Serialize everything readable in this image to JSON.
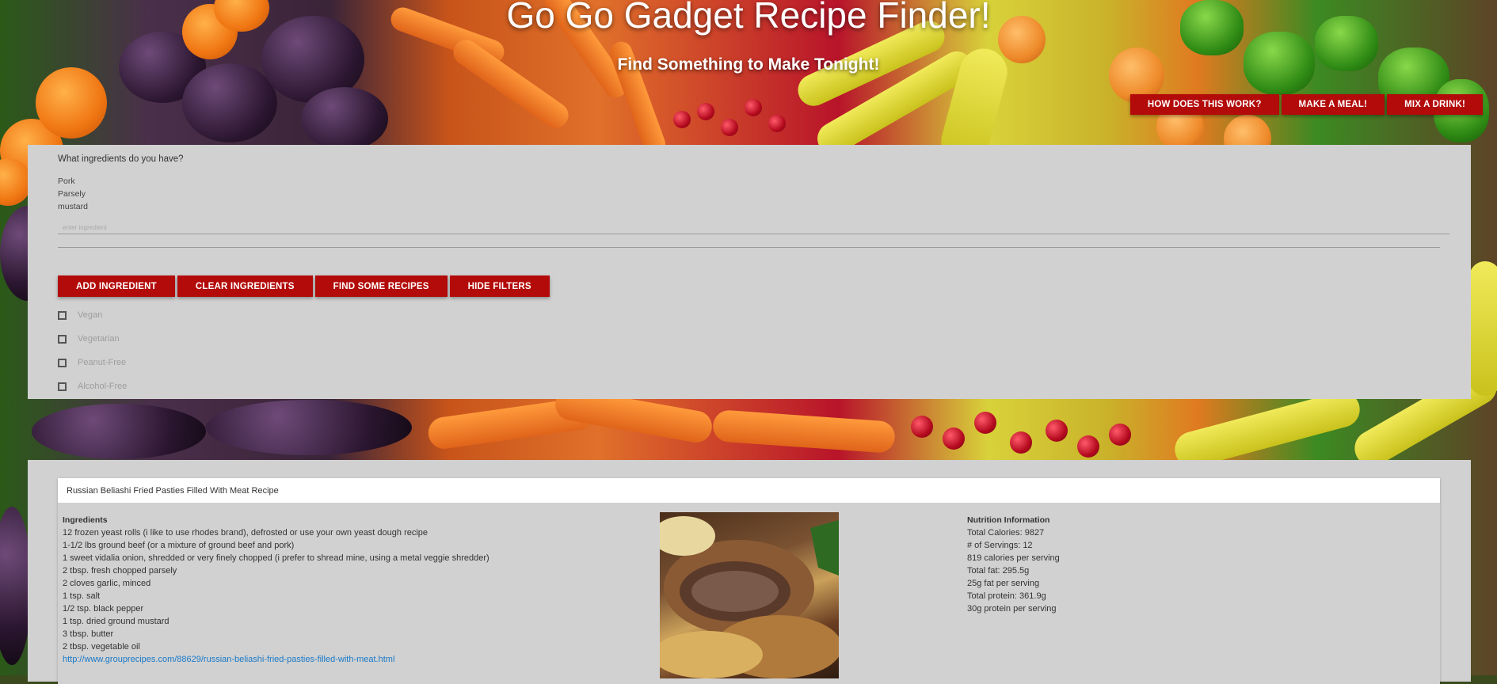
{
  "header": {
    "title": "Go Go Gadget Recipe Finder!",
    "subtitle": "Find Something to Make Tonight!",
    "nav": [
      "HOW DOES THIS WORK?",
      "MAKE A MEAL!",
      "MIX A DRINK!"
    ]
  },
  "search": {
    "prompt": "What ingredients do you have?",
    "ingredients": [
      "Pork",
      "Parsely",
      "mustard"
    ],
    "input_placeholder": "enter ingredient",
    "input_value": "",
    "actions": [
      "ADD INGREDIENT",
      "CLEAR INGREDIENTS",
      "FIND SOME RECIPES",
      "HIDE FILTERS"
    ],
    "filters": [
      {
        "label": "Vegan",
        "checked": false
      },
      {
        "label": "Vegetarian",
        "checked": false
      },
      {
        "label": "Peanut-Free",
        "checked": false
      },
      {
        "label": "Alcohol-Free",
        "checked": false
      }
    ]
  },
  "result": {
    "title": "Russian Beliashi Fried Pasties Filled With Meat Recipe",
    "ingredients_header": "Ingredients",
    "ingredients": [
      "12 frozen yeast rolls (i like to use rhodes brand), defrosted or use your own yeast dough recipe",
      "1-1/2 lbs ground beef (or a mixture of ground beef and pork)",
      "1 sweet vidalia onion, shredded or very finely chopped (i prefer to shread mine, using a metal veggie shredder)",
      "2 tbsp. fresh chopped parsely",
      "2 cloves garlic, minced",
      "1 tsp. salt",
      "1/2 tsp. black pepper",
      "1 tsp. dried ground mustard",
      "3 tbsp. butter",
      "2 tbsp. vegetable oil"
    ],
    "link": "http://www.grouprecipes.com/88629/russian-beliashi-fried-pasties-filled-with-meat.html",
    "nutrition_header": "Nutrition Information",
    "nutrition": [
      "Total Calories: 9827",
      "# of Servings: 12",
      "819 calories per serving",
      "Total fat: 295.5g",
      "25g fat per serving",
      "Total protein: 361.9g",
      "30g protein per serving"
    ]
  }
}
